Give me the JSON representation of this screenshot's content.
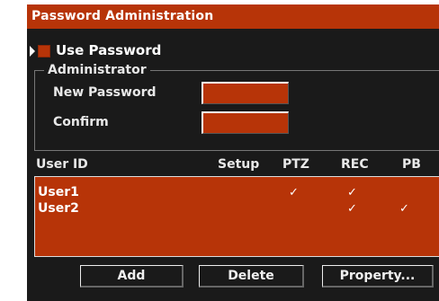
{
  "window": {
    "title": "Password Administration"
  },
  "use_password": {
    "label": "Use Password",
    "checked": true
  },
  "administrator": {
    "group_label": "Administrator",
    "new_password_label": "New Password",
    "new_password_value": "",
    "confirm_label": "Confirm",
    "confirm_value": ""
  },
  "user_table": {
    "columns": [
      "User ID",
      "Setup",
      "PTZ",
      "REC",
      "PB"
    ],
    "rows": [
      {
        "user": "User1",
        "setup": false,
        "ptz": true,
        "rec": true,
        "pb": false
      },
      {
        "user": "User2",
        "setup": false,
        "ptz": false,
        "rec": true,
        "pb": true
      }
    ],
    "check_glyph": "✓"
  },
  "buttons": {
    "add": "Add",
    "delete": "Delete",
    "property": "Property..."
  },
  "colors": {
    "accent": "#b73408",
    "background": "#1a1a1a",
    "text": "#ffffff"
  },
  "icons": {
    "pointer": "pointer-triangle-icon",
    "check": "checkmark-icon"
  }
}
